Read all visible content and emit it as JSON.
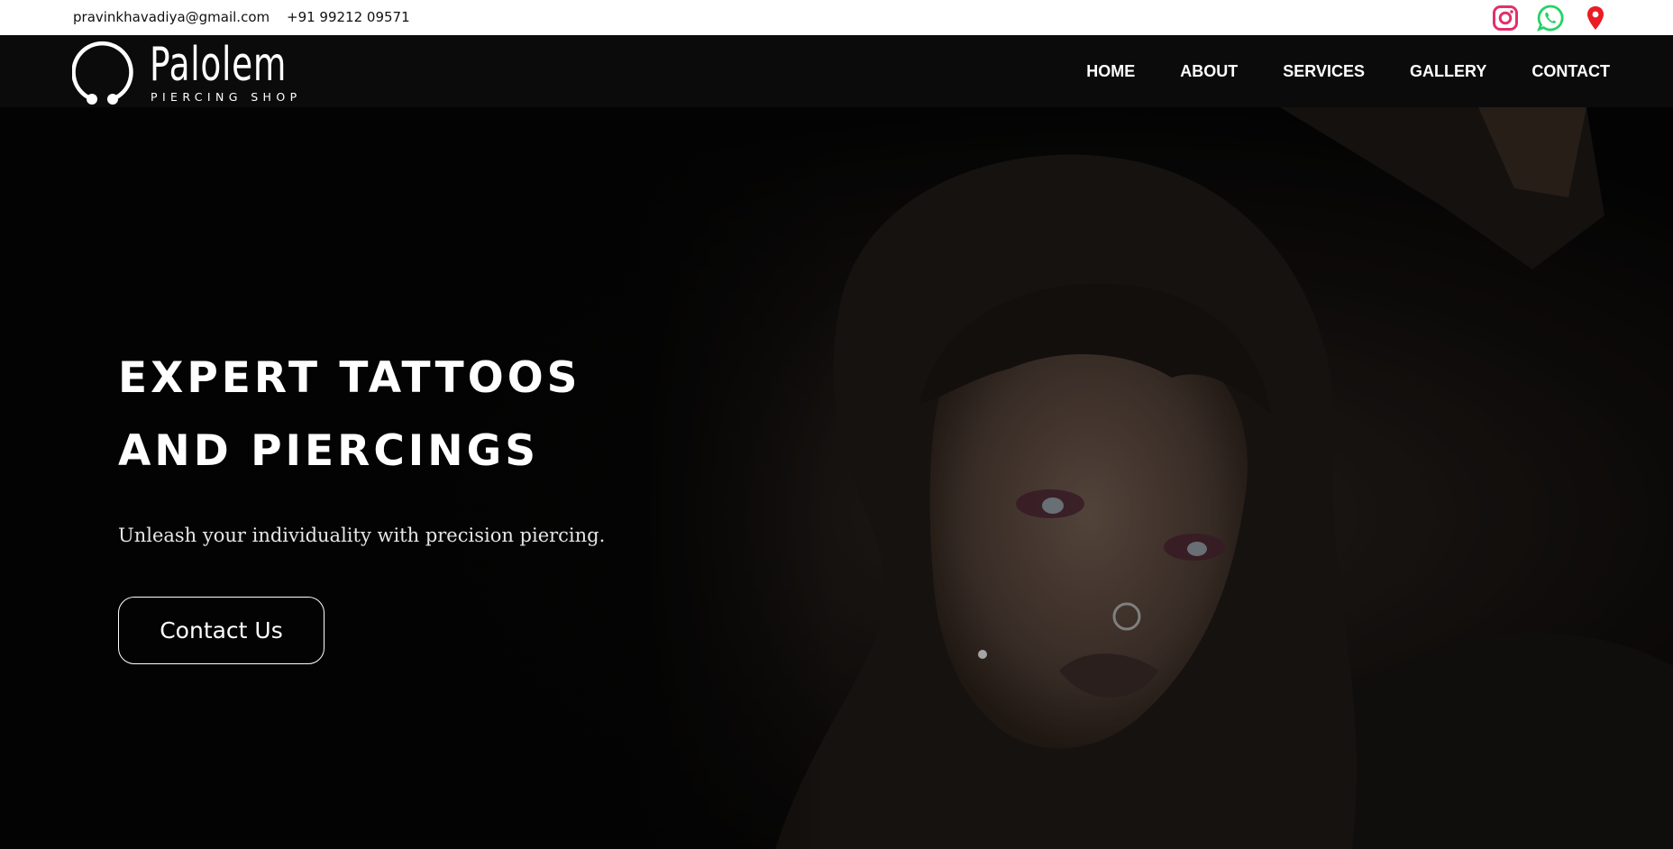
{
  "topbar": {
    "email": "pravinkhavadiya@gmail.com",
    "phone": "+91 99212 09571",
    "social": [
      {
        "icon": "instagram-icon",
        "color": "#e1306c"
      },
      {
        "icon": "whatsapp-icon",
        "color": "#25d366"
      },
      {
        "icon": "map-pin-icon",
        "color": "#ea1c24"
      }
    ]
  },
  "brand": {
    "name": "Palolem",
    "tagline": "PIERCING SHOP"
  },
  "nav": {
    "items": [
      "HOME",
      "ABOUT",
      "SERVICES",
      "GALLERY",
      "CONTACT"
    ]
  },
  "hero": {
    "title_line1": "EXPERT TATTOOS",
    "title_line2": "AND PIERCINGS",
    "subtitle": "Unleash your individuality with precision piercing.",
    "cta_label": "Contact Us"
  },
  "colors": {
    "nav_bg": "#0b0b0b",
    "hero_bg": "#050505",
    "text": "#ffffff"
  }
}
